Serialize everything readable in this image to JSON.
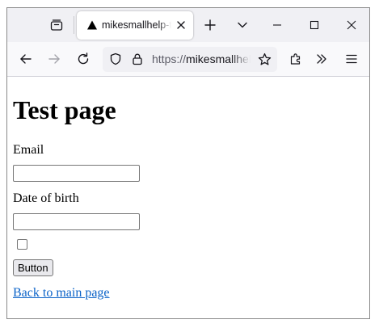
{
  "browser": {
    "tab": {
      "title": "mikesmallhelp-test"
    },
    "url": {
      "scheme": "https://",
      "host": "mikesmallhelp-test"
    },
    "icons": {
      "tab_list": "tab-list-icon",
      "tab_favicon": "triangle-favicon",
      "tab_close": "close-icon",
      "new_tab": "plus-icon",
      "all_tabs": "chevron-down-icon",
      "minimize": "minimize-icon",
      "maximize": "maximize-icon",
      "close_window": "close-icon",
      "back": "back-arrow-icon",
      "forward": "forward-arrow-icon",
      "reload": "reload-icon",
      "tracking_protection": "shield-icon",
      "site_security": "lock-icon",
      "bookmark": "star-icon",
      "extensions": "puzzle-icon",
      "overflow": "double-chevron-icon",
      "menu": "hamburger-icon"
    }
  },
  "page": {
    "title": "Test page",
    "email_label": "Email",
    "email_value": "",
    "dob_label": "Date of birth",
    "dob_value": "",
    "checkbox_checked": false,
    "button_label": "Button",
    "link_text": "Back to main page"
  },
  "colors": {
    "tabbar_bg": "#f0f0f4",
    "navbar_bg": "#f9f9fb",
    "link": "#0b63c8"
  }
}
